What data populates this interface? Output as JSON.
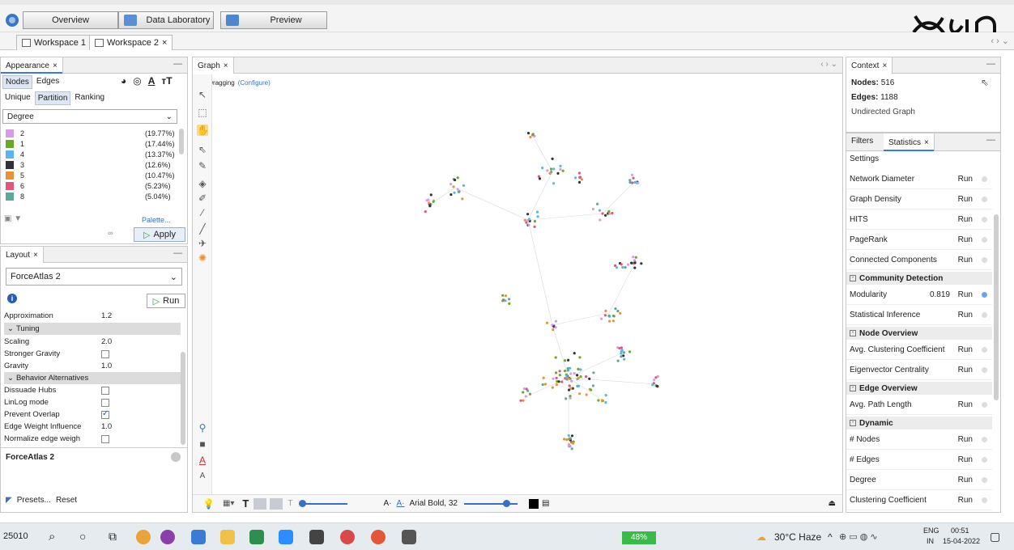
{
  "modes": {
    "overview": "Overview",
    "data_lab": "Data Laboratory",
    "preview": "Preview"
  },
  "workspaces": [
    "Workspace 1",
    "Workspace 2"
  ],
  "appearance": {
    "tab": "Appearance",
    "sub_nodes": "Nodes",
    "sub_edges": "Edges",
    "mode_unique": "Unique",
    "mode_partition": "Partition",
    "mode_ranking": "Ranking",
    "attribute": "Degree",
    "legend": [
      {
        "label": "2",
        "pct": "(19.77%)",
        "color": "#d59de6"
      },
      {
        "label": "1",
        "pct": "(17.44%)",
        "color": "#6aa82c"
      },
      {
        "label": "4",
        "pct": "(13.37%)",
        "color": "#5ab4ee"
      },
      {
        "label": "3",
        "pct": "(12.6%)",
        "color": "#333333"
      },
      {
        "label": "5",
        "pct": "(10.47%)",
        "color": "#e8913b"
      },
      {
        "label": "6",
        "pct": "(5.23%)",
        "color": "#e0567e"
      },
      {
        "label": "8",
        "pct": "(5.04%)",
        "color": "#5fa69b"
      }
    ],
    "palette": "Palette...",
    "apply": "Apply"
  },
  "layout": {
    "tab": "Layout",
    "algorithm": "ForceAtlas 2",
    "run": "Run",
    "approximation_label": "Approximation",
    "approximation_value": "1.2",
    "tuning": "Tuning",
    "scaling_label": "Scaling",
    "scaling_value": "2.0",
    "stronger_gravity": "Stronger Gravity",
    "gravity_label": "Gravity",
    "gravity_value": "1.0",
    "behavior": "Behavior Alternatives",
    "dissuade_hubs": "Dissuade Hubs",
    "linlog": "LinLog mode",
    "prevent_overlap": "Prevent Overlap",
    "edge_weight_label": "Edge Weight Influence",
    "edge_weight_value": "1.0",
    "normalize": "Normalize edge weigh",
    "description_title": "ForceAtlas 2",
    "presets": "Presets...",
    "reset": "Reset"
  },
  "graph": {
    "tab": "Graph",
    "status": "Dragging",
    "configure": "(Configure)",
    "font_label": "Arial Bold, 32"
  },
  "context": {
    "tab": "Context",
    "nodes_label": "Nodes:",
    "nodes_value": "516",
    "edges_label": "Edges:",
    "edges_value": "1188",
    "graph_type": "Undirected Graph"
  },
  "statistics": {
    "tab_filters": "Filters",
    "tab_statistics": "Statistics",
    "settings": "Settings",
    "run": "Run",
    "rows_1": [
      "Network Diameter",
      "Graph Density",
      "HITS",
      "PageRank",
      "Connected Components"
    ],
    "group_community": "Community Detection",
    "modularity_label": "Modularity",
    "modularity_value": "0.819",
    "statistical_inference": "Statistical Inference",
    "group_node": "Node Overview",
    "rows_node": [
      "Avg. Clustering Coefficient",
      "Eigenvector Centrality"
    ],
    "group_edge": "Edge Overview",
    "avg_path": "Avg. Path Length",
    "group_dynamic": "Dynamic",
    "rows_dynamic": [
      "# Nodes",
      "# Edges",
      "Degree",
      "Clustering Coefficient"
    ]
  },
  "taskbar": {
    "corner_label": "25010",
    "battery": "48%",
    "weather": "30°C Haze",
    "lang_top": "ENG",
    "lang_bottom": "IN",
    "time": "00:51",
    "date": "15-04-2022"
  }
}
